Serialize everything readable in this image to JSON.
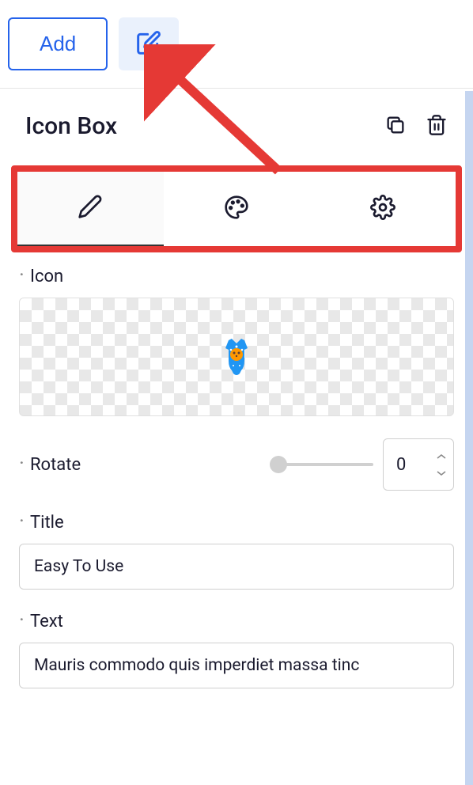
{
  "topbar": {
    "add_label": "Add"
  },
  "panel": {
    "title": "Icon Box"
  },
  "fields": {
    "icon_label": "Icon",
    "rotate_label": "Rotate",
    "rotate_value": "0",
    "title_label": "Title",
    "title_value": "Easy To Use",
    "text_label": "Text",
    "text_value": "Mauris commodo quis imperdiet massa tinc"
  }
}
